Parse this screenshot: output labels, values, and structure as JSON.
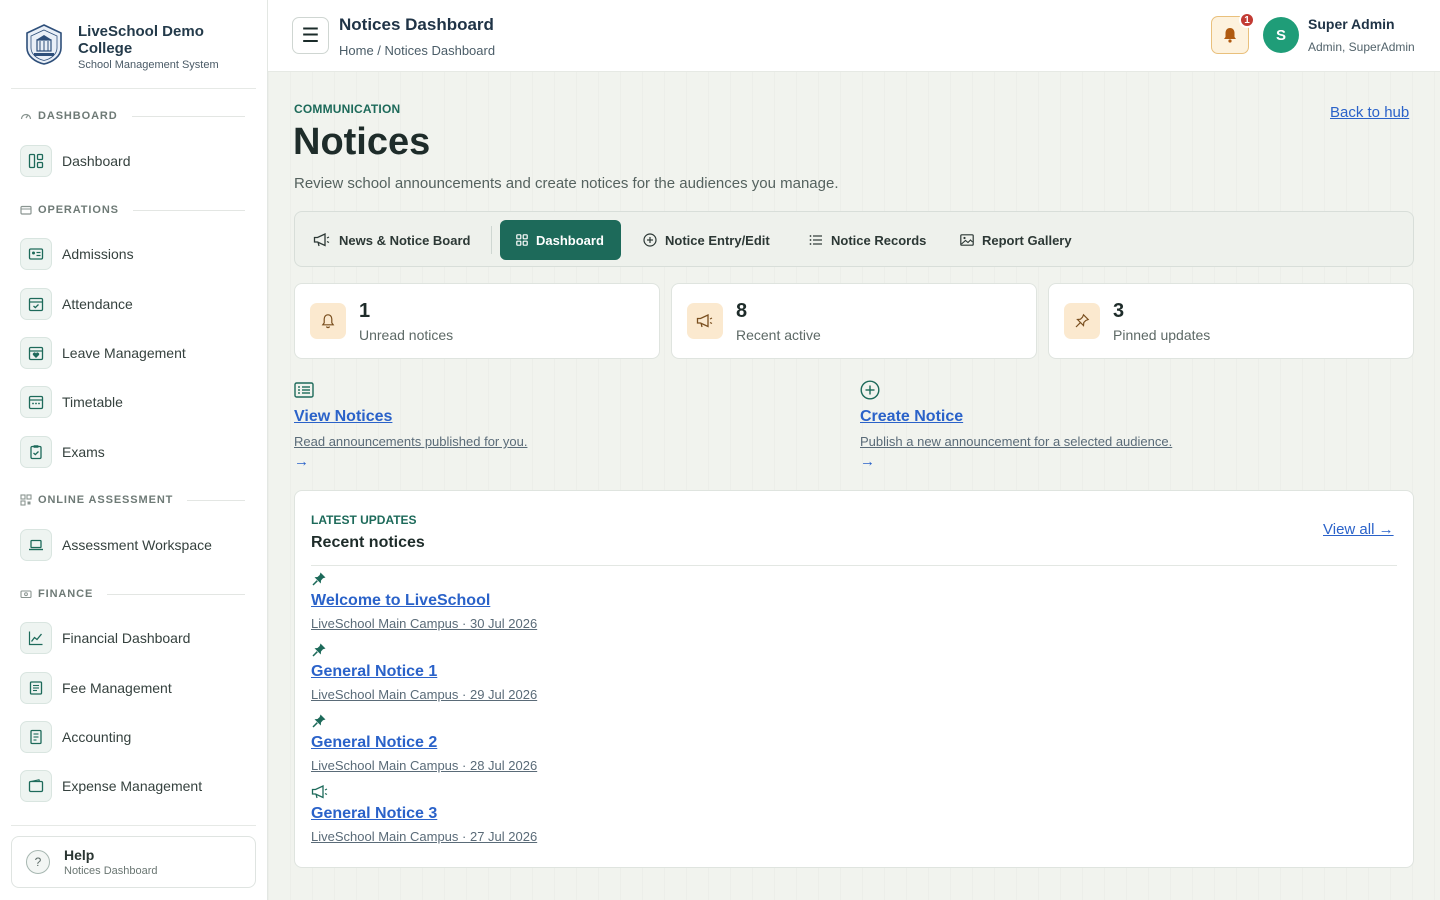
{
  "brand": {
    "name": "LiveSchool Demo College",
    "subtitle": "School Management System"
  },
  "sidebar": {
    "sections": [
      {
        "label": "DASHBOARD"
      },
      {
        "label": "OPERATIONS"
      },
      {
        "label": "ONLINE ASSESSMENT"
      },
      {
        "label": "FINANCE"
      }
    ],
    "items": [
      {
        "label": "Dashboard",
        "icon": "layout-icon"
      },
      {
        "label": "Admissions",
        "icon": "id-card-icon"
      },
      {
        "label": "Attendance",
        "icon": "calendar-check-icon"
      },
      {
        "label": "Leave Management",
        "icon": "calendar-heart-icon"
      },
      {
        "label": "Timetable",
        "icon": "calendar-grid-icon"
      },
      {
        "label": "Exams",
        "icon": "clipboard-check-icon"
      },
      {
        "label": "Assessment Workspace",
        "icon": "laptop-icon"
      },
      {
        "label": "Financial Dashboard",
        "icon": "chart-line-icon"
      },
      {
        "label": "Fee Management",
        "icon": "receipt-icon"
      },
      {
        "label": "Accounting",
        "icon": "ledger-icon"
      },
      {
        "label": "Expense Management",
        "icon": "wallet-icon"
      }
    ],
    "help": {
      "title": "Help",
      "subtitle": "Notices Dashboard"
    }
  },
  "header": {
    "title": "Notices Dashboard",
    "breadcrumb": "Home / Notices Dashboard",
    "notification_count": "1",
    "avatar_initial": "S",
    "user_name": "Super Admin",
    "user_role": "Admin, SuperAdmin"
  },
  "page": {
    "eyebrow": "COMMUNICATION",
    "title": "Notices",
    "description": "Review school announcements and create notices for the audiences you manage.",
    "back_link": "Back to hub"
  },
  "tabs": [
    {
      "label": "News & Notice Board",
      "icon": "megaphone-icon",
      "active": false
    },
    {
      "label": "Dashboard",
      "icon": "grid-icon",
      "active": true
    },
    {
      "label": "Notice Entry/Edit",
      "icon": "plus-circle-icon",
      "active": false
    },
    {
      "label": "Notice Records",
      "icon": "list-icon",
      "active": false
    },
    {
      "label": "Report Gallery",
      "icon": "image-icon",
      "active": false
    }
  ],
  "stats": [
    {
      "value": "1",
      "label": "Unread notices",
      "icon": "bell-icon"
    },
    {
      "value": "8",
      "label": "Recent active",
      "icon": "megaphone-icon"
    },
    {
      "value": "3",
      "label": "Pinned updates",
      "icon": "pin-icon"
    }
  ],
  "actions": [
    {
      "title": "View Notices",
      "description": "Read announcements published for you.",
      "arrow": "→",
      "icon": "newspaper-icon"
    },
    {
      "title": "Create Notice",
      "description": "Publish a new announcement for a selected audience.",
      "arrow": "→",
      "icon": "plus-circle-icon"
    }
  ],
  "recent": {
    "eyebrow": "LATEST UPDATES",
    "title": "Recent notices",
    "view_all": "View all →",
    "notices": [
      {
        "title": "Welcome to LiveSchool",
        "meta": "LiveSchool Main Campus · 30 Jul 2026",
        "icon": "pin-icon"
      },
      {
        "title": "General Notice 1",
        "meta": "LiveSchool Main Campus · 29 Jul 2026",
        "icon": "pin-icon"
      },
      {
        "title": "General Notice 2",
        "meta": "LiveSchool Main Campus · 28 Jul 2026",
        "icon": "pin-icon"
      },
      {
        "title": "General Notice 3",
        "meta": "LiveSchool Main Campus · 27 Jul 2026",
        "icon": "megaphone-icon"
      }
    ]
  },
  "colors": {
    "accent": "#1d6a5a",
    "link": "#2a62c9",
    "badge": "#c23b34",
    "avatar": "#1f9d78"
  }
}
